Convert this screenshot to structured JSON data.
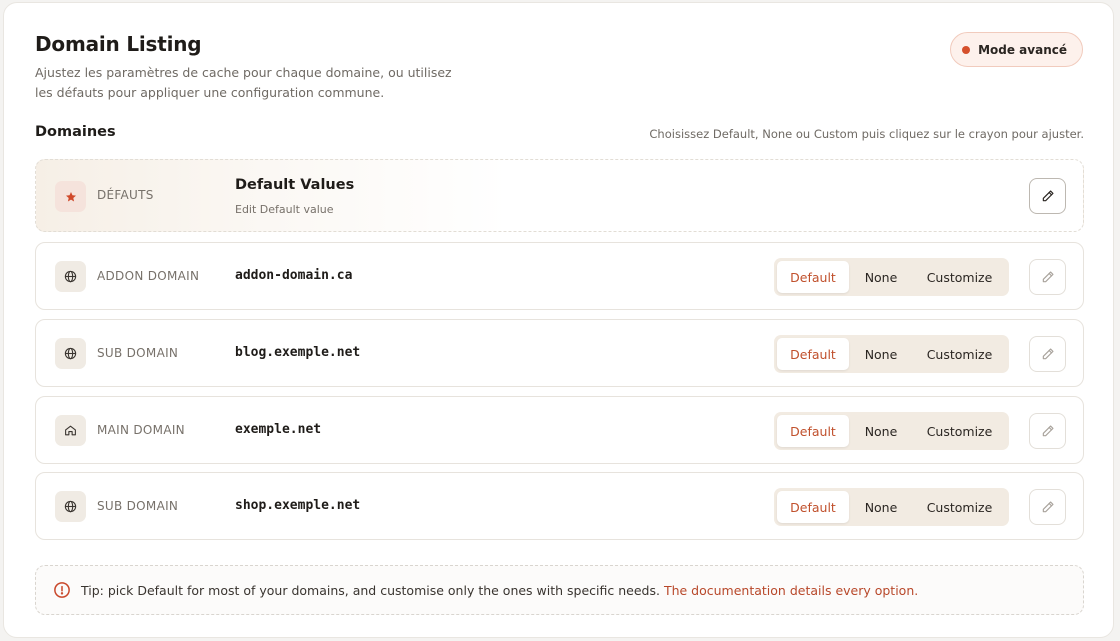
{
  "header": {
    "title": "Domain Listing",
    "subtitle": "Ajustez les paramètres de cache pour chaque domaine, ou utilisez les défauts pour appliquer une configuration commune.",
    "mode_badge": "Mode avancé"
  },
  "section": {
    "title": "Domaines",
    "hint": "Choisissez Default, None ou Custom puis cliquez sur le crayon pour ajuster."
  },
  "defaults_row": {
    "type": "DÉFAUTS",
    "title": "Default Values",
    "subtitle": "Edit Default value",
    "icon": "star-icon"
  },
  "segment_options": [
    "Default",
    "None",
    "Customize"
  ],
  "domains": [
    {
      "type": "ADDON DOMAIN",
      "domain": "addon-domain.ca",
      "icon": "globe-icon",
      "selected": "Default"
    },
    {
      "type": "SUB DOMAIN",
      "domain": "blog.exemple.net",
      "icon": "globe-icon",
      "selected": "Default"
    },
    {
      "type": "MAIN DOMAIN",
      "domain": "exemple.net",
      "icon": "home-icon",
      "selected": "Default"
    },
    {
      "type": "SUB DOMAIN",
      "domain": "shop.exemple.net",
      "icon": "globe-icon",
      "selected": "Default"
    }
  ],
  "tip": {
    "text": "Tip: pick Default for most of your domains, and customise only the ones with specific needs.",
    "link": "The documentation details every option."
  },
  "colors": {
    "accent": "#c0502c",
    "badge_dot": "#d5502c"
  }
}
